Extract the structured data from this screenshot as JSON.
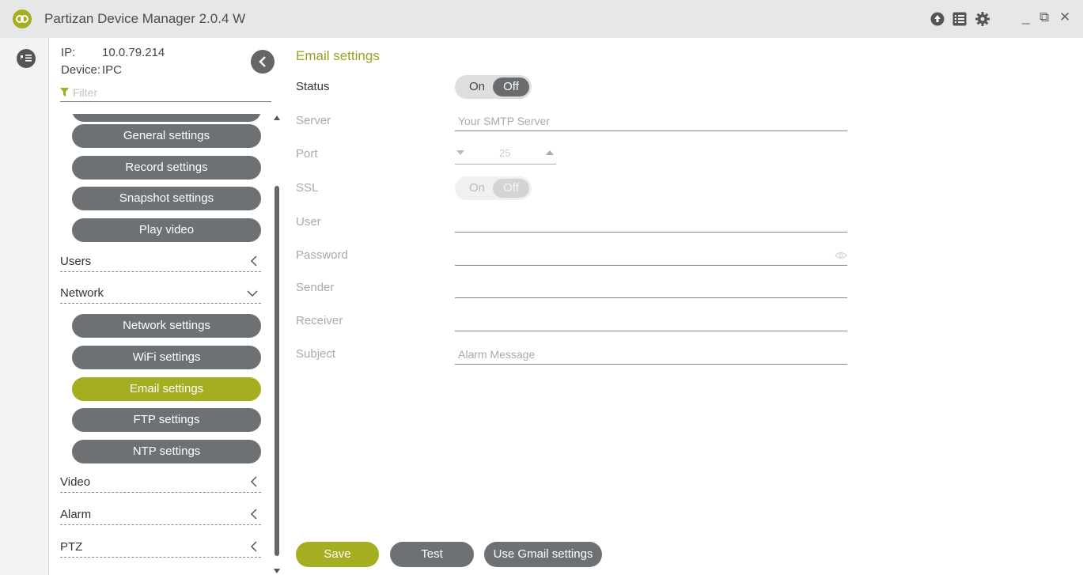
{
  "app": {
    "title": "Partizan Device Manager 2.0.4 W"
  },
  "titlebar_icons": [
    "upload-icon",
    "list-icon",
    "gear-icon"
  ],
  "window_controls": {
    "minimize": "_",
    "restore": "⧉",
    "close": "✕"
  },
  "device": {
    "ip_label": "IP:",
    "ip": "10.0.79.214",
    "device_label": "Device:",
    "device": "IPC",
    "filter_placeholder": "Filter"
  },
  "nav": {
    "top_items": [
      "General settings",
      "Record settings",
      "Snapshot settings",
      "Play video"
    ],
    "users": "Users",
    "network": "Network",
    "network_items": [
      "Network settings",
      "WiFi settings",
      "Email settings",
      "FTP settings",
      "NTP settings"
    ],
    "active_item": "Email settings",
    "video": "Video",
    "alarm": "Alarm",
    "ptz": "PTZ"
  },
  "form": {
    "title": "Email settings",
    "status": {
      "label": "Status",
      "on": "On",
      "off": "Off",
      "value": "Off"
    },
    "server": {
      "label": "Server",
      "placeholder": "Your SMTP Server"
    },
    "port": {
      "label": "Port",
      "value": "25"
    },
    "ssl": {
      "label": "SSL",
      "on": "On",
      "off": "Off",
      "value": "Off"
    },
    "user": {
      "label": "User",
      "value": ""
    },
    "password": {
      "label": "Password",
      "value": ""
    },
    "sender": {
      "label": "Sender",
      "value": ""
    },
    "receiver": {
      "label": "Receiver",
      "value": ""
    },
    "subject": {
      "label": "Subject",
      "placeholder": "Alarm Message"
    }
  },
  "buttons": {
    "save": "Save",
    "test": "Test",
    "gmail": "Use Gmail settings"
  },
  "colors": {
    "accent": "#a5ad20",
    "pill": "#6e7174",
    "titlebar": "#e7e7e7"
  }
}
